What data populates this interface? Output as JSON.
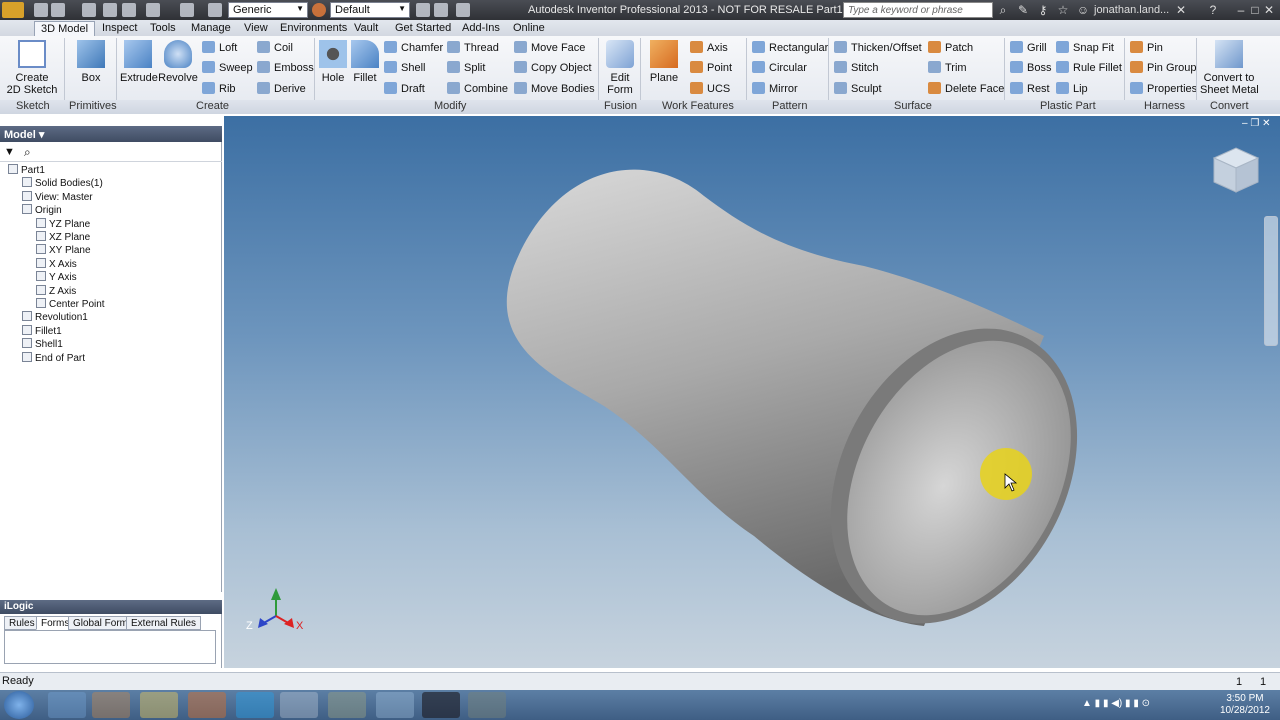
{
  "titlebar": {
    "title": "Autodesk Inventor Professional 2013 - NOT FOR RESALE   Part1",
    "material_combo": "Generic",
    "appearance_combo": "Default",
    "search_placeholder": "Type a keyword or phrase",
    "user": "jonathan.land..."
  },
  "tabs": [
    "3D Model",
    "Inspect",
    "Tools",
    "Manage",
    "View",
    "Environments",
    "Vault",
    "Get Started",
    "Add-Ins",
    "Online"
  ],
  "active_tab": "3D Model",
  "ribbon": {
    "sketch": {
      "create_2d_sketch": "Create\n2D Sketch",
      "group": "Sketch"
    },
    "primitives": {
      "box": "Box",
      "group": "Primitives"
    },
    "create": {
      "extrude": "Extrude",
      "revolve": "Revolve",
      "loft": "Loft",
      "sweep": "Sweep",
      "rib": "Rib",
      "coil": "Coil",
      "emboss": "Emboss",
      "derive": "Derive",
      "group": "Create"
    },
    "modify": {
      "hole": "Hole",
      "fillet": "Fillet",
      "chamfer": "Chamfer",
      "shell": "Shell",
      "draft": "Draft",
      "thread": "Thread",
      "split": "Split",
      "combine": "Combine",
      "move_face": "Move Face",
      "copy_object": "Copy Object",
      "move_bodies": "Move Bodies",
      "group": "Modify"
    },
    "fusion": {
      "edit_form": "Edit\nForm",
      "group": "Fusion"
    },
    "work_features": {
      "plane": "Plane",
      "axis": "Axis",
      "point": "Point",
      "ucs": "UCS",
      "group": "Work Features"
    },
    "pattern": {
      "rectangular": "Rectangular",
      "circular": "Circular",
      "mirror": "Mirror",
      "group": "Pattern"
    },
    "surface": {
      "thicken_offset": "Thicken/Offset",
      "stitch": "Stitch",
      "sculpt": "Sculpt",
      "patch": "Patch",
      "trim": "Trim",
      "delete_face": "Delete Face",
      "group": "Surface"
    },
    "plastic_part": {
      "grill": "Grill",
      "boss": "Boss",
      "rest": "Rest",
      "snap_fit": "Snap Fit",
      "rule_fillet": "Rule Fillet",
      "lip": "Lip",
      "group": "Plastic Part"
    },
    "harness": {
      "pin": "Pin",
      "pin_group": "Pin Group",
      "properties": "Properties",
      "group": "Harness"
    },
    "convert": {
      "convert_to_sheet_metal": "Convert to\nSheet Metal",
      "group": "Convert"
    }
  },
  "model_browser": {
    "title": "Model",
    "tree": [
      {
        "label": "Part1",
        "level": 0
      },
      {
        "label": "Solid Bodies(1)",
        "level": 1
      },
      {
        "label": "View: Master",
        "level": 1
      },
      {
        "label": "Origin",
        "level": 1
      },
      {
        "label": "YZ Plane",
        "level": 2
      },
      {
        "label": "XZ Plane",
        "level": 2
      },
      {
        "label": "XY Plane",
        "level": 2
      },
      {
        "label": "X Axis",
        "level": 2
      },
      {
        "label": "Y Axis",
        "level": 2
      },
      {
        "label": "Z Axis",
        "level": 2
      },
      {
        "label": "Center Point",
        "level": 2
      },
      {
        "label": "Revolution1",
        "level": 1
      },
      {
        "label": "Fillet1",
        "level": 1
      },
      {
        "label": "Shell1",
        "level": 1
      },
      {
        "label": "End of Part",
        "level": 1
      }
    ]
  },
  "ilogic": {
    "title": "iLogic",
    "tabs": [
      "Rules",
      "Forms",
      "Global Forms",
      "External Rules"
    ],
    "selected_tab": "Forms"
  },
  "viewport": {
    "triad_x": "X",
    "triad_z": "Z"
  },
  "status": {
    "text": "Ready",
    "right1": "1",
    "right2": "1"
  },
  "taskbar": {
    "time": "3:50 PM",
    "date": "10/28/2012"
  }
}
